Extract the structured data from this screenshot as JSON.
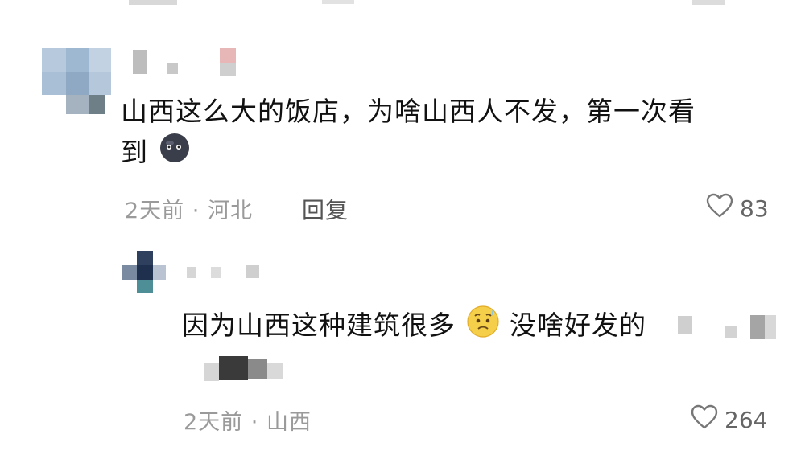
{
  "comments": [
    {
      "text_line1": "山西这么大的饭店，为啥山西人不发，第一次看",
      "text_line2": "到",
      "emoji": "dark-round-face-emoji",
      "time": "2天前",
      "separator": "·",
      "location": "河北",
      "reply_label": "回复",
      "likes": "83"
    },
    {
      "text": "因为山西这种建筑很多",
      "emoji": "sweating-worried-face-emoji",
      "text_after_emoji": "没啥好发的",
      "time": "2天前",
      "separator": "·",
      "location": "山西",
      "likes": "264"
    }
  ],
  "colors": {
    "text": "#111111",
    "meta": "#9a9a9a",
    "heart_outline": "#777777"
  },
  "icons": [
    "heart-outline-icon",
    "heart-outline-icon"
  ]
}
